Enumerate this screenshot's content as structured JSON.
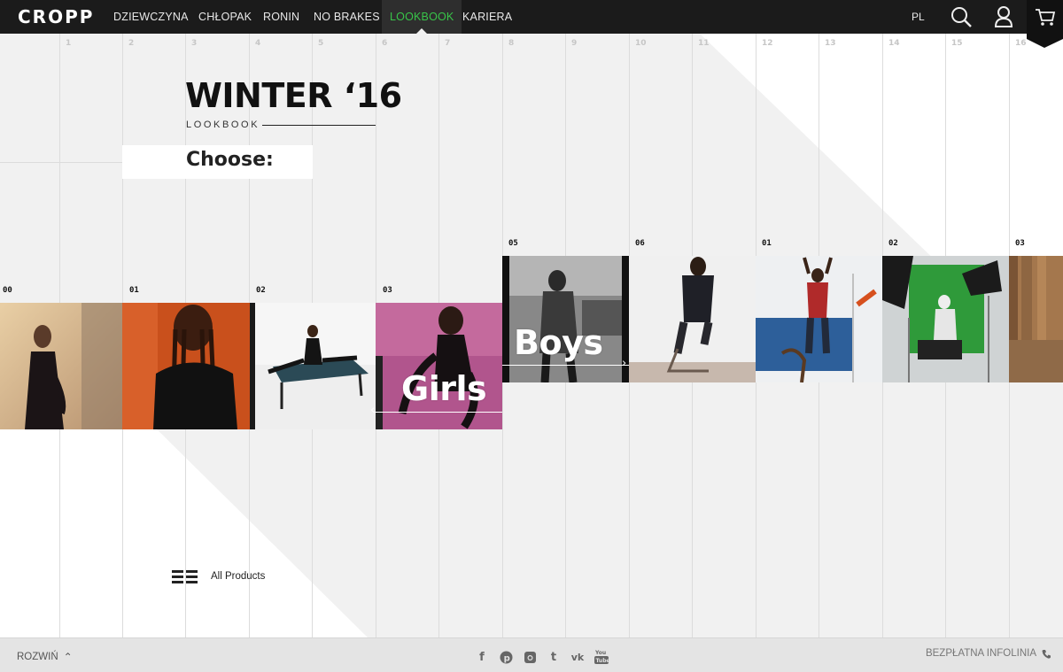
{
  "brand": {
    "logo": "CROPP"
  },
  "nav": {
    "items": [
      {
        "label": "DZIEWCZYNA"
      },
      {
        "label": "CHŁOPAK"
      },
      {
        "label": "RONIN"
      },
      {
        "label": "NO BRAKES"
      },
      {
        "label": "LOOKBOOK"
      },
      {
        "label": "KARIERA"
      }
    ],
    "active": "LOOKBOOK",
    "lang": "PL",
    "icons": [
      "search-icon",
      "user-icon",
      "cart-icon"
    ]
  },
  "grid": {
    "columns": [
      "1",
      "2",
      "3",
      "4",
      "5",
      "6",
      "7",
      "8",
      "9",
      "10",
      "11",
      "12",
      "13",
      "14",
      "15",
      "16"
    ]
  },
  "hero": {
    "title": "WINTER ‘16",
    "subtitle": "LOOKBOOK",
    "choose": "Choose:"
  },
  "girls": {
    "label": "Girls",
    "tiles": [
      {
        "num": "00"
      },
      {
        "num": "01"
      },
      {
        "num": "02"
      },
      {
        "num": "03"
      }
    ]
  },
  "boys": {
    "label": "Boys",
    "tiles": [
      {
        "num": "05"
      },
      {
        "num": "06"
      },
      {
        "num": "01"
      },
      {
        "num": "02"
      },
      {
        "num": "03"
      }
    ]
  },
  "all_products": {
    "label": "All Products",
    "icon": "list-icon"
  },
  "footer": {
    "expand_label": "ROZWIŃ",
    "hotline_label": "BEZPŁATNA INFOLINIA",
    "social": [
      "facebook-icon",
      "pinterest-icon",
      "instagram-icon",
      "tumblr-icon",
      "vk-icon",
      "youtube-icon"
    ]
  },
  "colors": {
    "accent": "#38c449",
    "nav_bg": "#1b1b1b",
    "page_bg": "#f2f2f2"
  }
}
